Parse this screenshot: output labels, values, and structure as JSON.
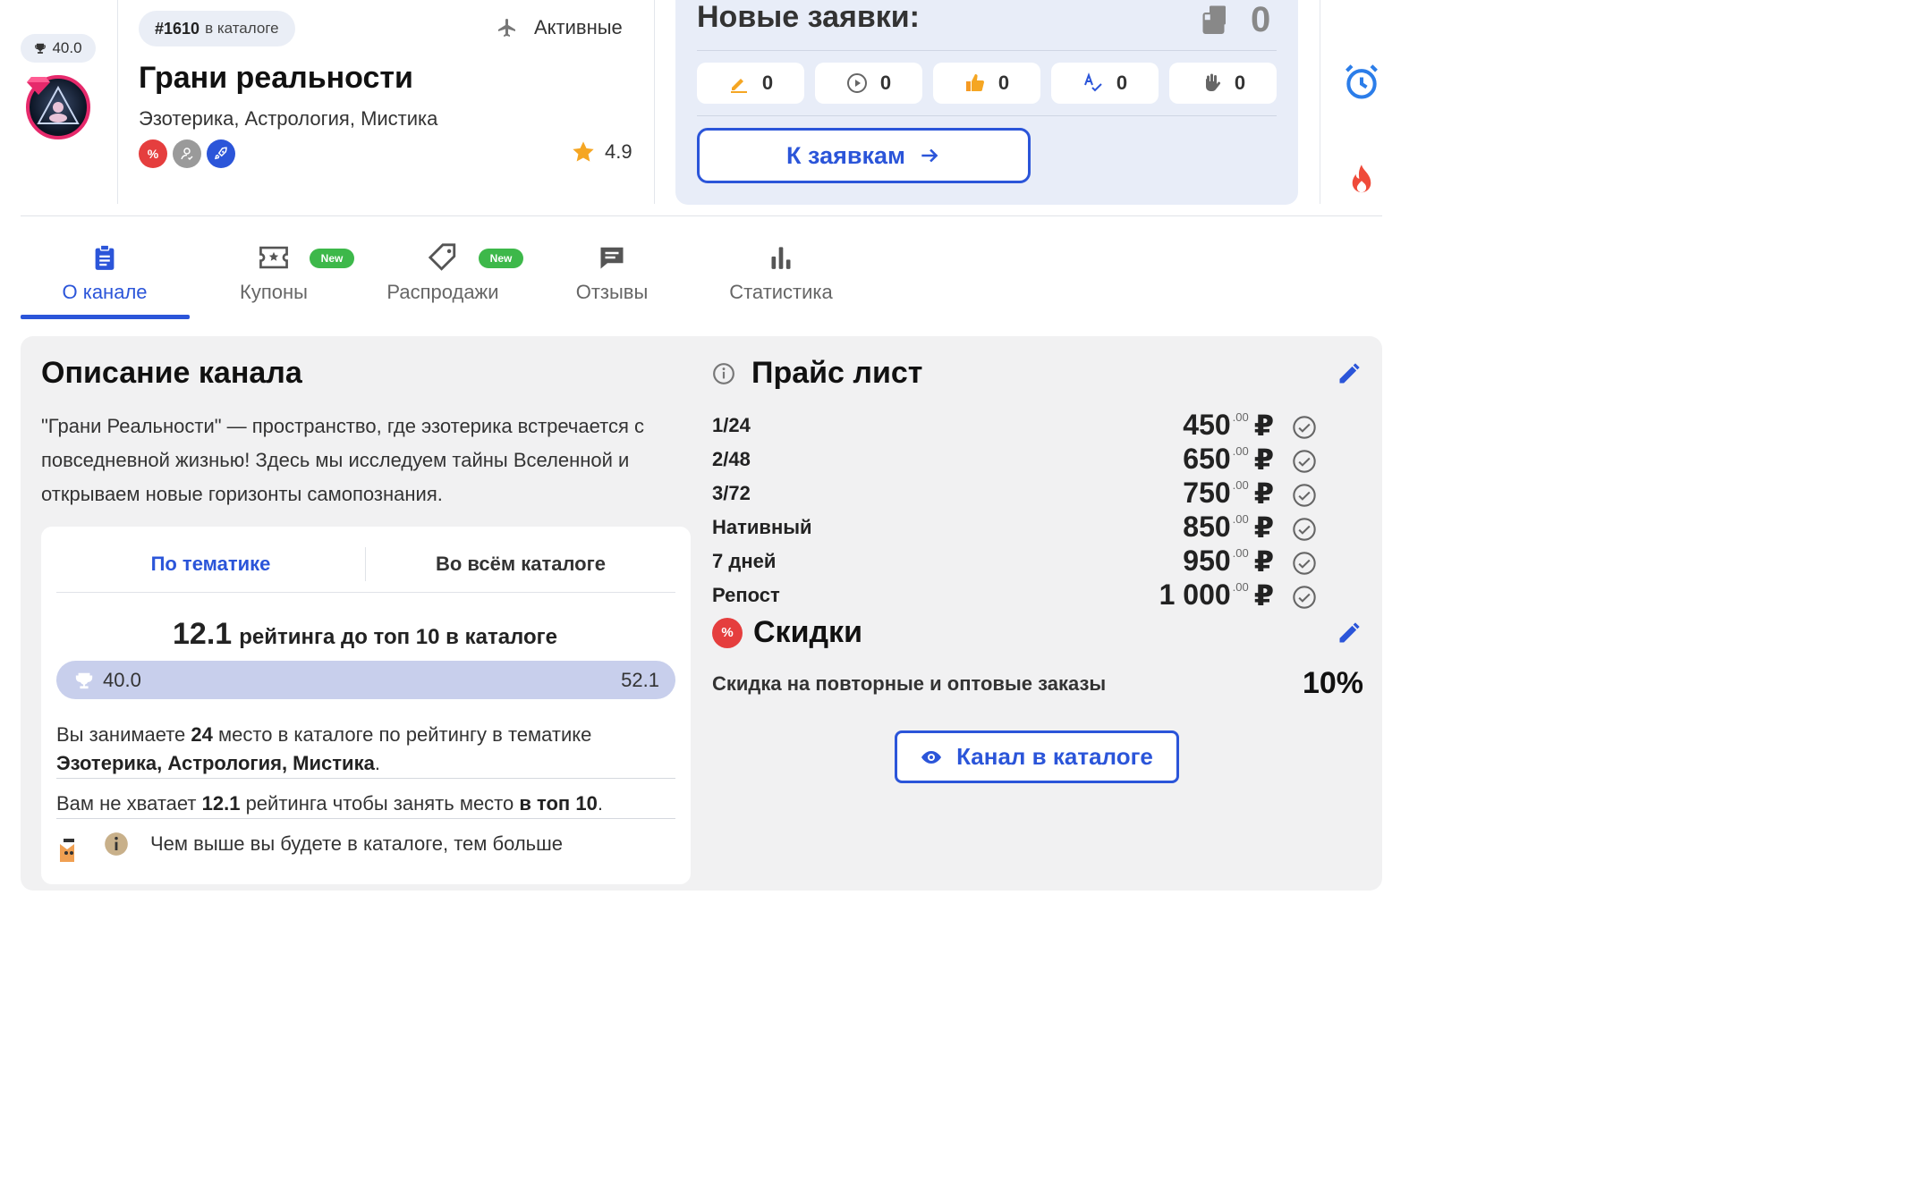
{
  "header": {
    "rating_value": "40.0",
    "catalog_number": "#1610",
    "catalog_suffix": "в каталоге",
    "status": "Активные",
    "title": "Грани реальности",
    "topics": "Эзотерика, Астрология, Мистика",
    "score": "4.9",
    "badges": [
      {
        "symbol": "%",
        "color": "#e53e3e"
      },
      {
        "symbol": "",
        "color": "#9a9a9a"
      },
      {
        "symbol": "",
        "color": "#2b55d9"
      }
    ]
  },
  "requests": {
    "title": "Новые заявки:",
    "total": "0",
    "stats": [
      {
        "icon": "pencil-icon",
        "value": "0"
      },
      {
        "icon": "play-circle-icon",
        "value": "0"
      },
      {
        "icon": "thumbs-up-icon",
        "value": "0"
      },
      {
        "icon": "spellcheck-icon",
        "value": "0"
      },
      {
        "icon": "hand-stop-icon",
        "value": "0"
      }
    ],
    "button_label": "К заявкам"
  },
  "tabs": [
    {
      "label": "О канале",
      "active": true,
      "new": false
    },
    {
      "label": "Купоны",
      "active": false,
      "new": true
    },
    {
      "label": "Распродажи",
      "active": false,
      "new": true
    },
    {
      "label": "Отзывы",
      "active": false,
      "new": false
    },
    {
      "label": "Статистика",
      "active": false,
      "new": false
    }
  ],
  "new_badge_label": "New",
  "description": {
    "title": "Описание канала",
    "text": "\"Грани Реальности\" — пространство, где эзотерика встречается с повседневной жизнью! Здесь мы исследуем тайны Вселенной и открываем новые горизонты самопознания."
  },
  "ranking": {
    "tab_topic": "По тематике",
    "tab_catalog": "Во всём каталоге",
    "gap_value": "12.1",
    "gap_text": "рейтинга до топ 10 в каталоге",
    "current": "40.0",
    "target": "52.1",
    "progress_fraction": 0.768,
    "place_line_1": "Вы занимаете",
    "place": "24",
    "place_line_2": "место в каталоге по рейтингу в тематике",
    "place_topic": "Эзотерика, Астрология, Мистика",
    "lack_line_1": "Вам не хватает",
    "lack_value": "12.1",
    "lack_line_2": "рейтинга чтобы занять место",
    "lack_target": "в топ 10",
    "hint": "Чем выше вы будете в каталоге, тем больше"
  },
  "price_list": {
    "title": "Прайс лист",
    "rows": [
      {
        "name": "1/24",
        "price": "450",
        "cents": ".00",
        "currency": "₽"
      },
      {
        "name": "2/48",
        "price": "650",
        "cents": ".00",
        "currency": "₽"
      },
      {
        "name": "3/72",
        "price": "750",
        "cents": ".00",
        "currency": "₽"
      },
      {
        "name": "Нативный",
        "price": "850",
        "cents": ".00",
        "currency": "₽"
      },
      {
        "name": "7 дней",
        "price": "950",
        "cents": ".00",
        "currency": "₽"
      },
      {
        "name": "Репост",
        "price": "1 000",
        "cents": ".00",
        "currency": "₽"
      }
    ]
  },
  "discounts": {
    "title": "Скидки",
    "badge": "%",
    "row_label": "Скидка на повторные и оптовые заказы",
    "row_value": "10%"
  },
  "catalog_button": "Канал в каталоге",
  "colors": {
    "accent": "#2b55d9",
    "new_badge": "#3db84a",
    "avatar_ring": "#e6296b",
    "star": "#f5a623"
  }
}
